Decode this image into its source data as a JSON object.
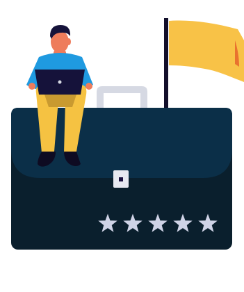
{
  "illustration": {
    "subject": "person-with-laptop-on-briefcase",
    "rating": {
      "stars_filled": 5,
      "stars_total": 5
    }
  },
  "colors": {
    "background": "#ffffff",
    "briefcase_body": "#0a1f2d",
    "briefcase_flap": "#0b2f48",
    "briefcase_handle": "#d6d9e3",
    "clasp": "#e7e9f1",
    "clasp_dot": "#1b1240",
    "star": "#cfd3e6",
    "flag": "#f8c247",
    "flag_fold": "#e9722f",
    "flag_pole": "#130f2b",
    "skin": "#ee7c5b",
    "hair": "#15123a",
    "shirt": "#1f9ae0",
    "pants": "#f5c242",
    "pants_shadow": "#c99a30",
    "laptop": "#15123a",
    "shoes": "#0e0b22"
  }
}
